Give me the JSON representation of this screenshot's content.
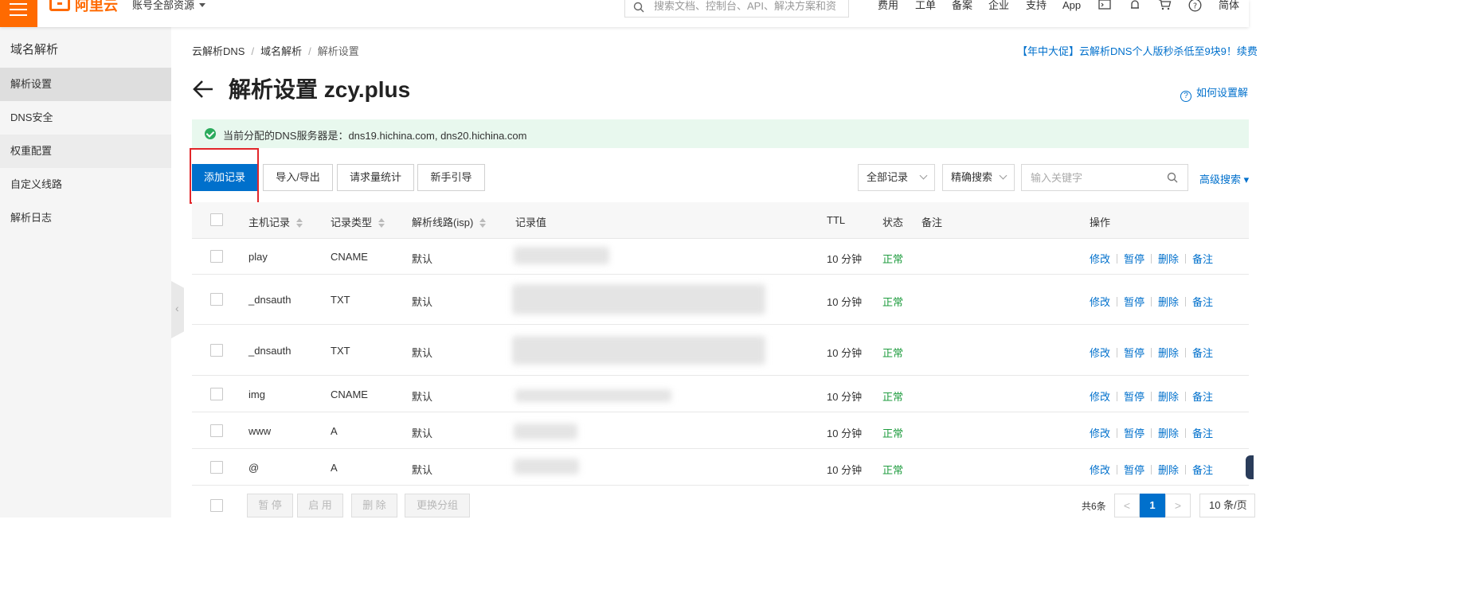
{
  "topbar": {
    "logo_text": "阿里云",
    "account_scope": "账号全部资源",
    "search_placeholder": "搜索文档、控制台、API、解决方案和资",
    "nav": [
      "费用",
      "工单",
      "备案",
      "企业",
      "支持",
      "App"
    ],
    "icons": [
      "terminal-icon",
      "bell-icon",
      "cart-icon",
      "help-icon"
    ],
    "language": "简体"
  },
  "sidebar": {
    "title": "域名解析",
    "items": [
      "解析设置",
      "DNS安全",
      "权重配置",
      "自定义线路",
      "解析日志"
    ],
    "active_index": 0
  },
  "breadcrumb": [
    "云解析DNS",
    "域名解析",
    "解析设置"
  ],
  "promo": "【年中大促】云解析DNS个人版秒杀低至9块9！续费",
  "page": {
    "title": "解析设置 zcy.plus",
    "help_link": "如何设置解"
  },
  "notice": "当前分配的DNS服务器是：dns19.hichina.com, dns20.hichina.com",
  "toolbar": {
    "add": "添加记录",
    "import_export": "导入/导出",
    "stats": "请求量统计",
    "guide": "新手引导",
    "filter_all": "全部记录",
    "search_mode": "精确搜索",
    "keyword_placeholder": "输入关键字",
    "advanced": "高级搜索"
  },
  "table": {
    "headers": {
      "host": "主机记录",
      "type": "记录类型",
      "line": "解析线路(isp)",
      "value": "记录值",
      "ttl": "TTL",
      "status": "状态",
      "remark": "备注",
      "actions": "操作"
    },
    "rows": [
      {
        "host": "play",
        "type": "CNAME",
        "line": "默认",
        "ttl": "10 分钟",
        "status": "正常"
      },
      {
        "host": "_dnsauth",
        "type": "TXT",
        "line": "默认",
        "ttl": "10 分钟",
        "status": "正常"
      },
      {
        "host": "_dnsauth",
        "type": "TXT",
        "line": "默认",
        "ttl": "10 分钟",
        "status": "正常"
      },
      {
        "host": "img",
        "type": "CNAME",
        "line": "默认",
        "ttl": "10 分钟",
        "status": "正常"
      },
      {
        "host": "www",
        "type": "A",
        "line": "默认",
        "ttl": "10 分钟",
        "status": "正常"
      },
      {
        "host": "@",
        "type": "A",
        "line": "默认",
        "ttl": "10 分钟",
        "status": "正常"
      }
    ],
    "row_actions": [
      "修改",
      "暂停",
      "删除",
      "备注"
    ]
  },
  "footer": {
    "bulk_actions": [
      "暂 停",
      "启 用",
      "删 除",
      "更换分组"
    ],
    "total": "共6条",
    "prev": "<",
    "current_page": "1",
    "next": ">",
    "page_size": "10 条/页"
  },
  "colors": {
    "brand_orange": "#ff6a00",
    "primary_blue": "#0070cc",
    "status_green": "#1f9c3f",
    "highlight_red": "#e2262a"
  }
}
